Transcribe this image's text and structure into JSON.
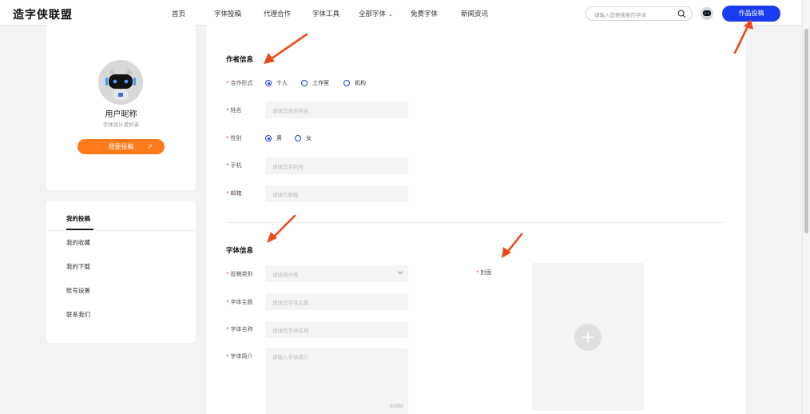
{
  "header": {
    "logo": "造字侠联盟",
    "nav": [
      "首页",
      "字体投稿",
      "代理合作",
      "字体工具",
      "全部字体",
      "免费字体",
      "新闻资讯"
    ],
    "search_placeholder": "请输入您要搜索的字体",
    "submit_label": "作品投稿"
  },
  "profile": {
    "nickname": "用户昵称",
    "subtitle": "字体设计爱好者",
    "post_button": "我要投稿",
    "post_arrow": "↗"
  },
  "menu": {
    "items": [
      "我的投稿",
      "我的收藏",
      "我的下载",
      "账号设置",
      "联系我们"
    ]
  },
  "author_section": {
    "title": "作者信息",
    "coop_label": "合作形式",
    "coop_options": [
      "个人",
      "工作室",
      "机构"
    ],
    "name_label": "姓名",
    "name_placeholder": "请填写真实姓名",
    "gender_label": "性别",
    "gender_options": [
      "男",
      "女"
    ],
    "phone_label": "手机",
    "phone_placeholder": "请填写手机号",
    "email_label": "邮箱",
    "email_placeholder": "请填写邮箱"
  },
  "font_section": {
    "title": "字体信息",
    "category_label": "投稿类别",
    "category_placeholder": "请选择分类",
    "theme_label": "字体主题",
    "theme_placeholder": "请填写字体主题",
    "fontname_label": "字体名称",
    "fontname_placeholder": "请填写字体名称",
    "intro_label": "字体简介",
    "intro_placeholder": "请输入字体简介",
    "intro_counter": "0/300",
    "cover_label": "封面"
  },
  "colors": {
    "primary": "#1a3cf0",
    "accent": "#ff7a1a",
    "required": "#e94b4b",
    "annotation_arrow": "#f04a1c"
  }
}
